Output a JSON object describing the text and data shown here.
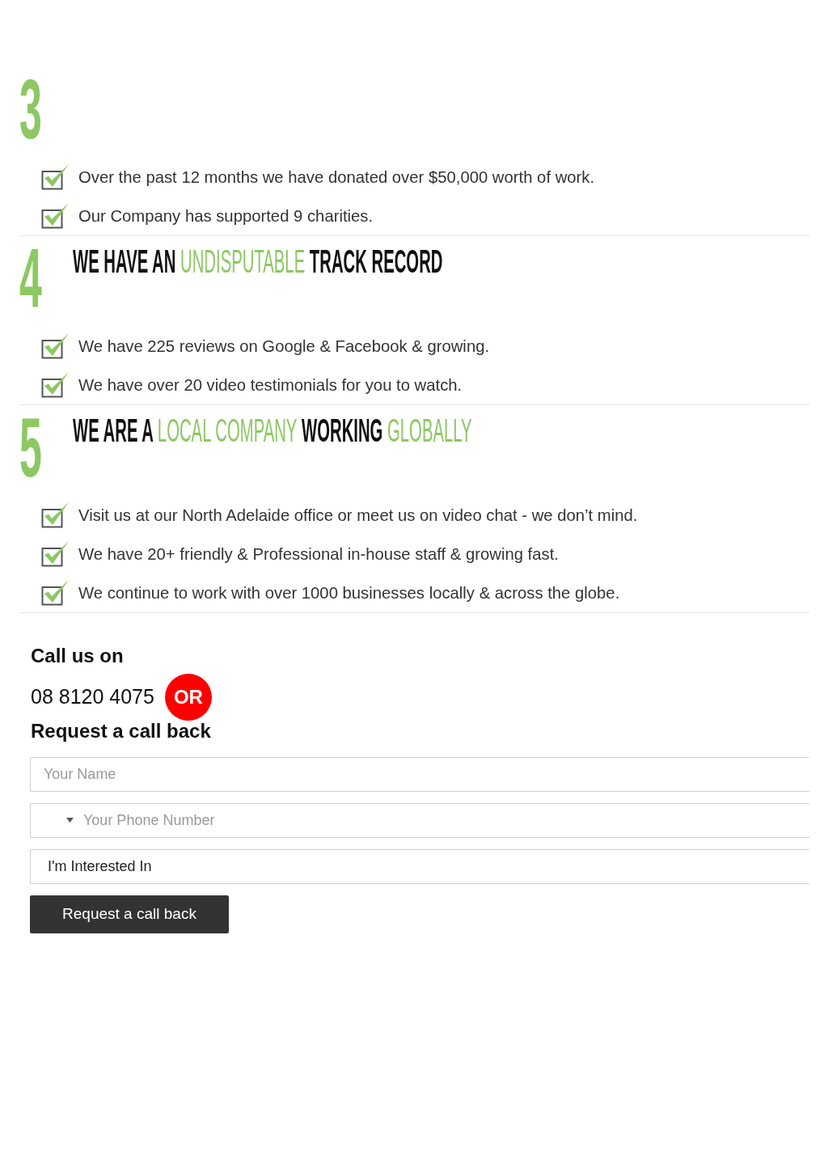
{
  "sections": [
    {
      "number": "3",
      "items": [
        "Over the past 12 months we have donated over $50,000 worth of work.",
        "Our Company has supported 9 charities."
      ]
    },
    {
      "number": "4",
      "heading": [
        {
          "text": "WE HAVE AN",
          "accent": false
        },
        {
          "text": "UNDISPUTABLE",
          "accent": true
        },
        {
          "text": "TRACK RECORD",
          "accent": false
        }
      ],
      "items": [
        "We have 225 reviews on Google & Facebook & growing.",
        "We have over 20 video testimonials for you to watch."
      ]
    },
    {
      "number": "5",
      "heading": [
        {
          "text": "WE ARE A",
          "accent": false
        },
        {
          "text": "LOCAL COMPANY",
          "accent": true
        },
        {
          "text": "WORKING",
          "accent": false
        },
        {
          "text": "GLOBALLY",
          "accent": true
        }
      ],
      "items": [
        "Visit us at our North Adelaide office or meet us on video chat - we don’t mind.",
        "We have 20+ friendly & Professional in-house staff & growing fast.",
        "We continue to work with over 1000 businesses locally & across the globe."
      ]
    }
  ],
  "contact": {
    "call_label": "Call us on",
    "phone": "08 8120 4075",
    "or_badge": "OR",
    "request_title": "Request a call back"
  },
  "form": {
    "fields": [
      {
        "kind": "text",
        "placeholder": "Your Name"
      },
      {
        "kind": "phone",
        "placeholder": "Your Phone Number"
      },
      {
        "kind": "select",
        "value": "I'm Interested In"
      }
    ],
    "submit": "Request a call back"
  }
}
